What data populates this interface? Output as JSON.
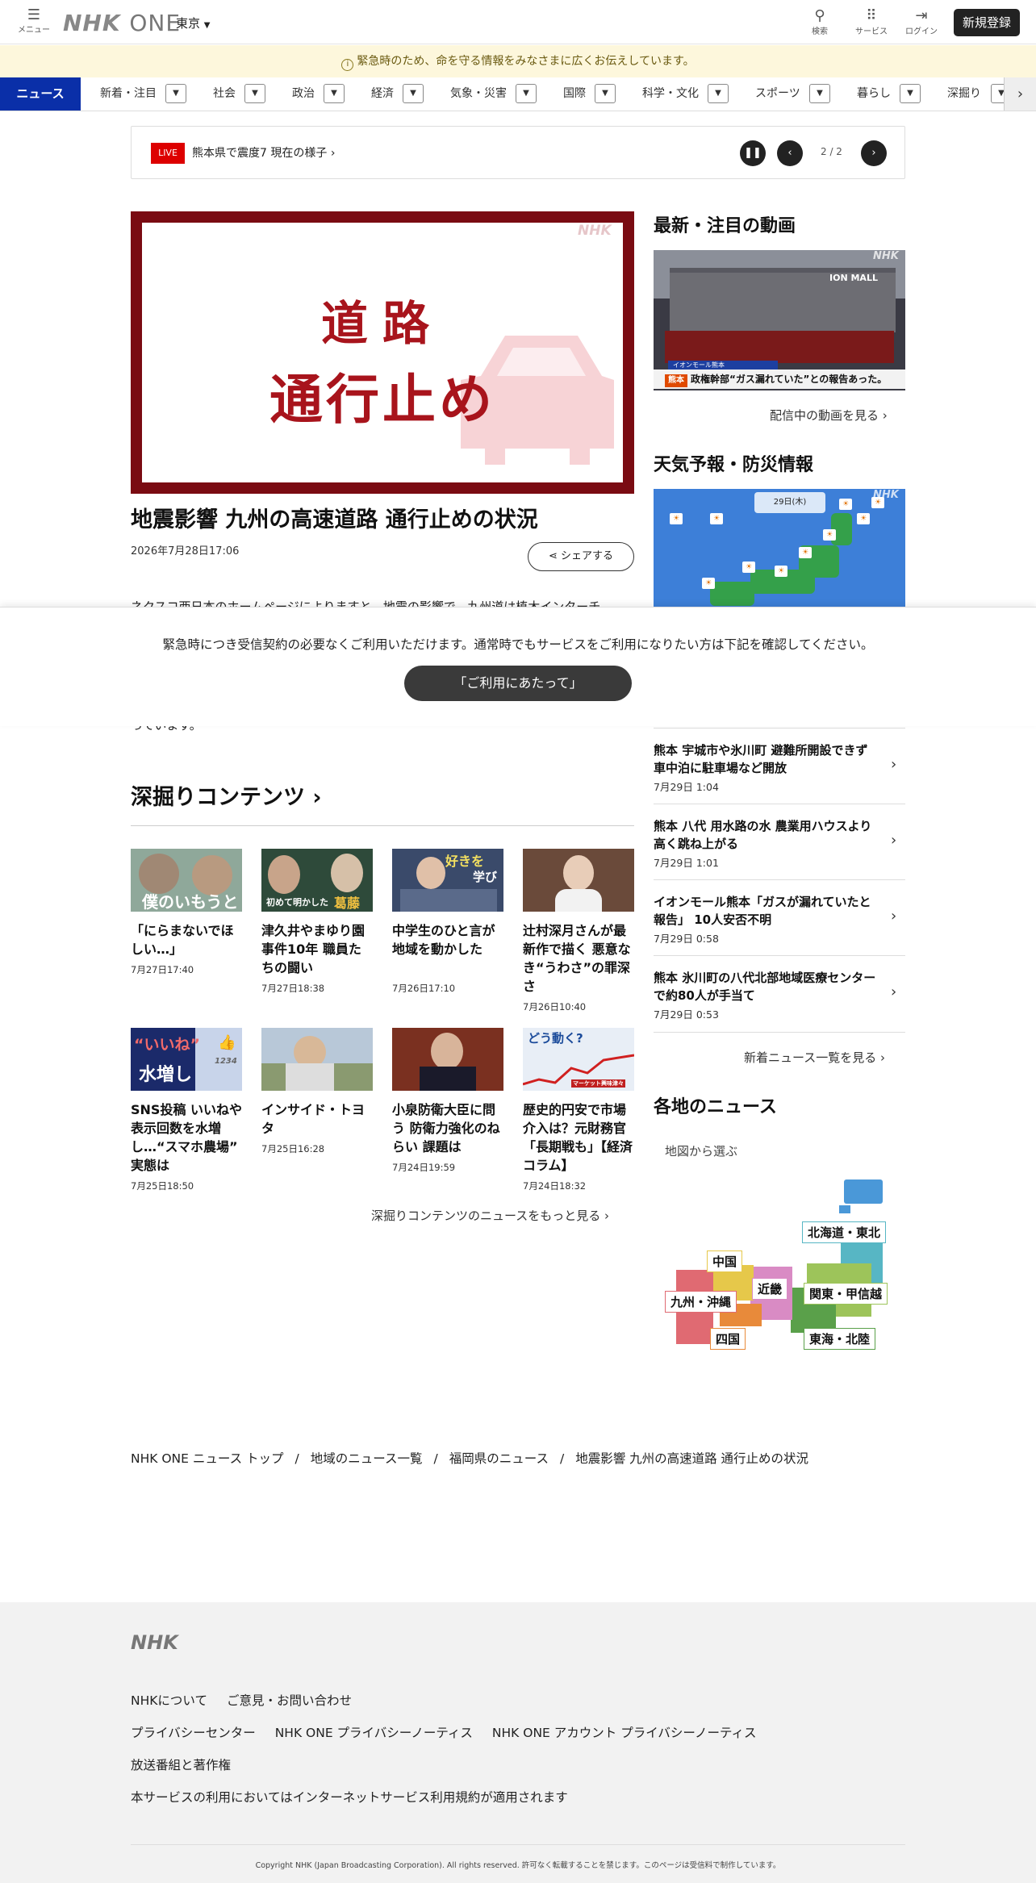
{
  "header": {
    "menu_label": "メニュー",
    "logo_main": "NHK",
    "logo_sub": "ONE",
    "region": "東京",
    "search_label": "検索",
    "services_label": "サービス",
    "login_label": "ログイン",
    "signup_label": "新規登録"
  },
  "notice": {
    "icon": "info-icon",
    "text": "緊急時のため、命を守る情報をみなさまに広くお伝えしています。"
  },
  "nav": {
    "active": "ニュース",
    "items": [
      "新着・注目",
      "社会",
      "政治",
      "経済",
      "気象・災害",
      "国際",
      "科学・文化",
      "スポーツ",
      "暮らし",
      "深掘り"
    ]
  },
  "ticker": {
    "live": "LIVE",
    "text": "熊本県で震度7 現在の様子",
    "page": "2 / 2"
  },
  "article": {
    "image_line1": "道路",
    "image_line2": "通行止め",
    "watermark": "NHK",
    "title": "地震影響 九州の高速道路 通行止めの状況",
    "date": "2026年7月28日17:06",
    "share_label": "シェアする",
    "body_partial": "ネクスコ西日本のホームページによりますと、地震の影響で、九州道は植木インターチ",
    "body_tail": "っています。"
  },
  "right": {
    "videos_heading": "最新・注目の動画",
    "video_sign": "ION MALL",
    "video_caption_small": "イオンモール熊本",
    "video_caption_tag": "熊本",
    "video_caption": "政権幹部“ガス漏れていた”との報告あった。",
    "videos_more": "配信中の動画を見る",
    "weather_heading": "天気予報・防災情報",
    "weather_date": "29日(木)",
    "news": [
      {
        "title": "熊本 宇城市や氷川町 避難所開設できず車中泊に駐車場など開放",
        "date": "7月29日 1:04"
      },
      {
        "title": "熊本 八代 用水路の水 農業用ハウスより高く跳ね上がる",
        "date": "7月29日 1:01"
      },
      {
        "title": "イオンモール熊本「ガスが漏れていたと報告」 10人安否不明",
        "date": "7月29日 0:58"
      },
      {
        "title": "熊本 氷川町の八代北部地域医療センターで約80人が手当て",
        "date": "7月29日 0:53"
      }
    ],
    "news_more": "新着ニュース一覧を見る",
    "local_heading": "各地のニュース",
    "map_label": "地図から選ぶ",
    "regions": {
      "hokkaido": "北海道・東北",
      "chugoku": "中国",
      "kinki": "近畿",
      "kyushu": "九州・沖縄",
      "kanto": "関東・甲信越",
      "shikoku": "四国",
      "tokai": "東海・北陸"
    }
  },
  "overlay": {
    "text": "緊急時につき受信契約の必要なくご利用いただけます。通常時でもサービスをご利用になりたい方は下記を確認してください。",
    "button": "「ご利用にあたって」"
  },
  "deepdive": {
    "heading": "深掘りコンテンツ",
    "cards": [
      {
        "title": "「にらまないでほしい…」",
        "date": "7月27日17:40",
        "img_text": "僕のいもうと"
      },
      {
        "title": "津久井やまゆり園事件10年 職員たちの闘い",
        "date": "7月27日18:38",
        "img_text": "初めて明かした",
        "img_text2": "葛藤"
      },
      {
        "title": "中学生のひと言が地域を動かした",
        "date": "7月26日17:10",
        "img_text": "好きを",
        "img_text2": "学び"
      },
      {
        "title": "辻村深月さんが最新作で描く 悪意なき“うわさ”の罪深さ",
        "date": "7月26日10:40"
      },
      {
        "title": "SNS投稿 いいねや表示回数を水増し…“スマホ農場” 実態は",
        "date": "7月25日18:50",
        "img_text": "“いいね”",
        "img_text2": "水増し",
        "img_text3": "1234"
      },
      {
        "title": "インサイド・トヨタ",
        "date": "7月25日16:28"
      },
      {
        "title": "小泉防衛大臣に問う 防衛力強化のねらい 課題は",
        "date": "7月24日19:59"
      },
      {
        "title": "歴史的円安で市場介入は？元財務官「長期戦も」【経済コラム】",
        "date": "7月24日18:32",
        "img_text": "どう動く?",
        "img_text2": "マーケット興味津々"
      }
    ],
    "more": "深掘りコンテンツのニュースをもっと見る"
  },
  "breadcrumb": [
    "NHK ONE ニュース トップ",
    "地域のニュース一覧",
    "福岡県のニュース",
    "地震影響 九州の高速道路 通行止めの状況"
  ],
  "footer": {
    "logo": "NHK",
    "row1": [
      "NHKについて",
      "ご意見・お問い合わせ"
    ],
    "row2": [
      "プライバシーセンター",
      "NHK ONE プライバシーノーティス",
      "NHK ONE アカウント プライバシーノーティス"
    ],
    "row3": [
      "放送番組と著作権"
    ],
    "row4": "本サービスの利用においてはインターネットサービス利用規約が適用されます",
    "copyright": "Copyright NHK (Japan Broadcasting Corporation). All rights reserved. 許可なく転載することを禁じます。このページは受信料で制作しています。"
  },
  "colors": {
    "accent": "#0a2fa8",
    "live": "#dd0000",
    "hero_frame": "#7a0b12",
    "notice_bg": "#fdf7dc"
  }
}
